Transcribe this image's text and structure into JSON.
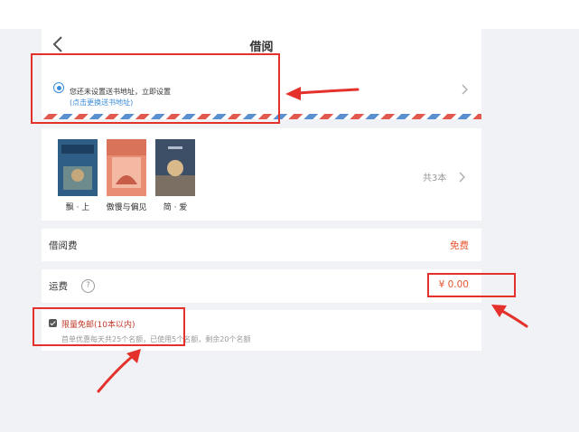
{
  "header": {
    "title": "借阅"
  },
  "address": {
    "prompt": "您还未设置送书地址，立即设置",
    "link": "(点击更换送书地址)"
  },
  "books": {
    "items": [
      {
        "label": "飘 · 上",
        "color": "#2e5d86"
      },
      {
        "label": "傲慢与偏见",
        "color": "#e98e74"
      },
      {
        "label": "简 · 爱",
        "color": "#3d4f66"
      }
    ],
    "count": "共3本"
  },
  "fees": {
    "borrow_label": "借阅费",
    "borrow_value": "免费",
    "shipping_label": "运费",
    "help": "?",
    "shipping_value": "¥ 0.00"
  },
  "promo": {
    "checked": true,
    "title": "限量免邮(10本以内)",
    "note": "首单优惠每天共25个名额，已使用5个名额，剩余20个名额"
  },
  "colors": {
    "accent": "#3a8bd8",
    "price": "#e8542e",
    "annotation": "#e4312b"
  }
}
